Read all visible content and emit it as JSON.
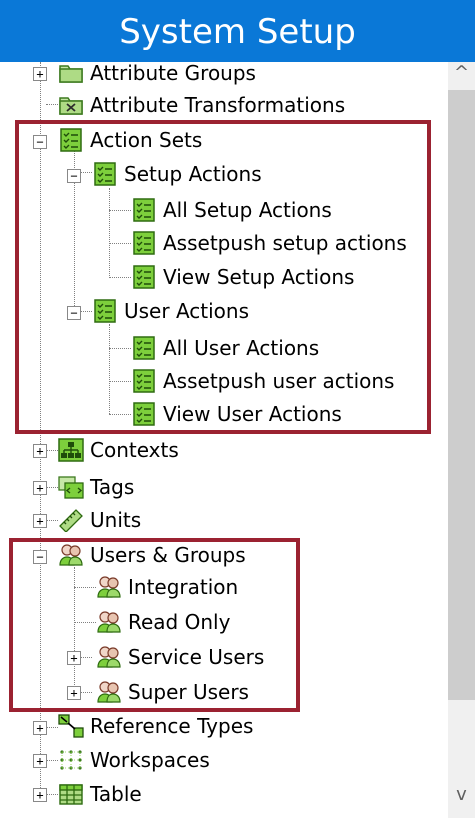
{
  "header": {
    "title": "System Setup"
  },
  "scrollbar": {
    "up": "^",
    "down": "v"
  },
  "tree": {
    "attribute_groups": "Attribute Groups",
    "attribute_transformations": "Attribute Transformations",
    "action_sets": "Action Sets",
    "setup_actions": "Setup Actions",
    "all_setup_actions": "All Setup Actions",
    "assetpush_setup_actions": "Assetpush setup actions",
    "view_setup_actions": "View Setup Actions",
    "user_actions": "User Actions",
    "all_user_actions": "All User Actions",
    "assetpush_user_actions": "Assetpush user actions",
    "view_user_actions": "View User Actions",
    "contexts": "Contexts",
    "tags": "Tags",
    "units": "Units",
    "users_groups": "Users & Groups",
    "integration": "Integration",
    "read_only": "Read Only",
    "service_users": "Service Users",
    "super_users": "Super Users",
    "reference_types": "Reference Types",
    "workspaces": "Workspaces",
    "table": "Table"
  },
  "expanders": {
    "plus": "+",
    "minus": "−"
  },
  "colors": {
    "header_bg": "#0a78d7",
    "highlight_border": "#9b2231",
    "action_icon": "#7dcf3c"
  }
}
